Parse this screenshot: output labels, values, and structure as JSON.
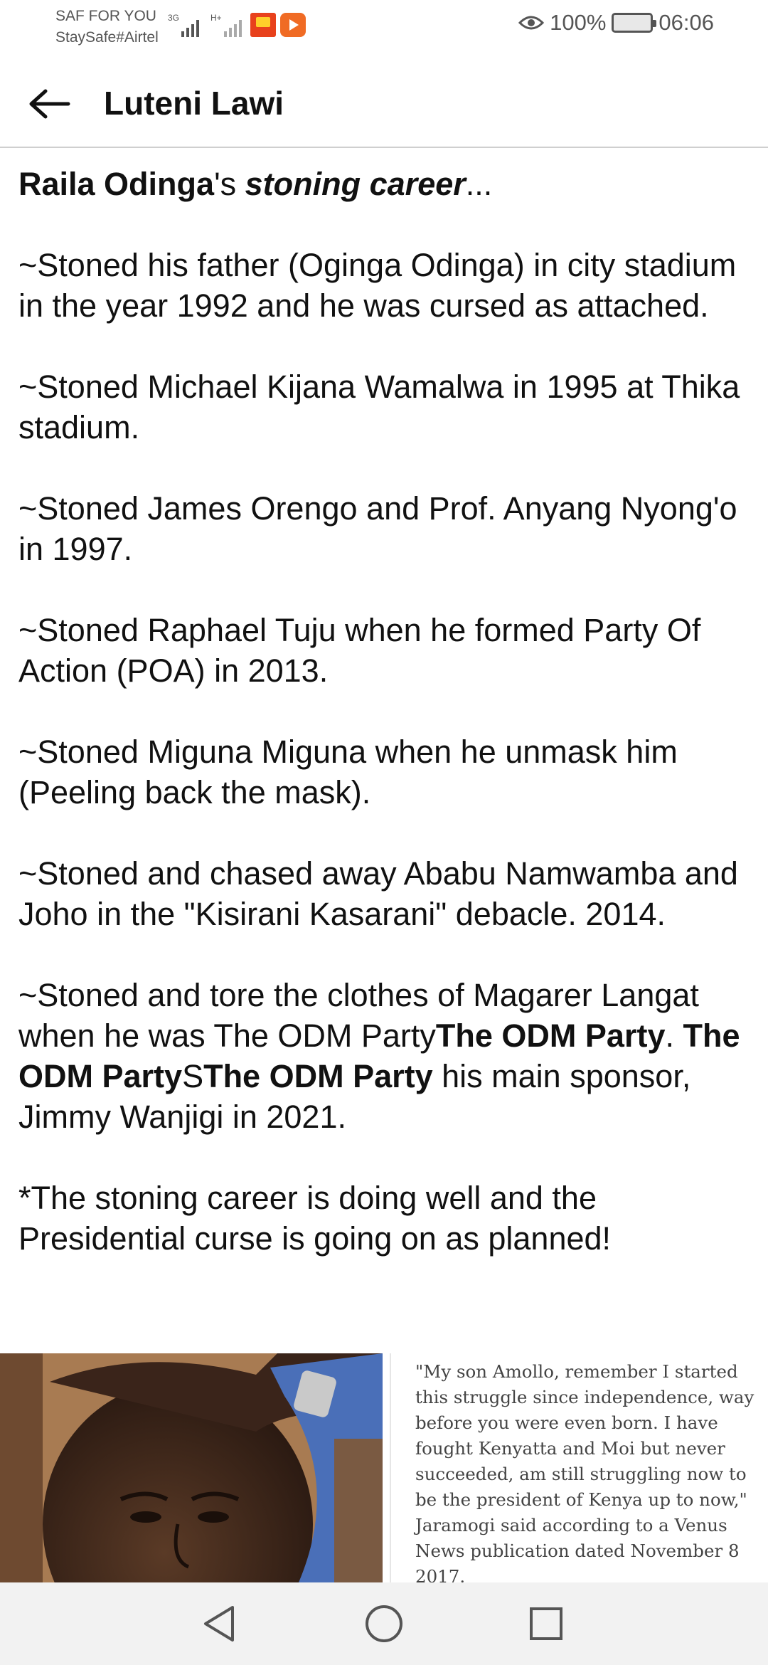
{
  "status_bar": {
    "carrier_line1": "SAF FOR YOU",
    "carrier_line2": "StaySafe#Airtel",
    "net1": "3G",
    "net2": "H+",
    "battery_percent": "100%",
    "time": "06:06",
    "icons": [
      "signal-icon",
      "signal-icon",
      "app-notification-icon",
      "video-app-icon",
      "eye-comfort-icon",
      "battery-icon"
    ]
  },
  "app_bar": {
    "title": "Luteni Lawi",
    "back_icon": "arrow-left-icon"
  },
  "post": {
    "p1": {
      "name": "Raila Odinga",
      "s": "'s ",
      "career": "stoning career",
      "ellipsis": "..."
    },
    "p2": "~Stoned his father (Oginga Odinga) in city stadium in the year 1992 and he was cursed as attached.",
    "p3": "~Stoned Michael Kijana Wamalwa in 1995 at Thika stadium.",
    "p4": "~Stoned James Orengo and Prof. Anyang Nyong'o in 1997.",
    "p5": "~Stoned Raphael Tuju when he formed Party Of Action (POA) in 2013.",
    "p6": "~Stoned Miguna Miguna when he unmask him (Peeling back the mask).",
    "p7": "~Stoned and chased away Ababu Namwamba and Joho in the \"Kisirani Kasarani\" debacle. 2014.",
    "p8": {
      "t1": "~Stoned and tore the clothes of Magarer Langat when he was The ODM Party",
      "b1": "The ODM Party",
      "t2": ". ",
      "b2": "The ODM Party",
      "t3": "S",
      "b3": "The ODM Party",
      "t4": " his main sponsor, Jimmy Wanjigi in 2021."
    },
    "p9": "*The stoning career is doing well and the Presidential curse is going on as planned!"
  },
  "attachment": {
    "quote": "\"My son Amollo, remember I started this struggle since independence, way before you were even born. I have fought Kenyatta and Moi but never succeeded, am still struggling now to be the president of Kenya up to now,\" Jaramogi said according to a Venus News publication dated November 8 2017."
  },
  "nav_bar": {
    "back": "nav-back-icon",
    "home": "nav-home-icon",
    "recents": "nav-recents-icon"
  }
}
